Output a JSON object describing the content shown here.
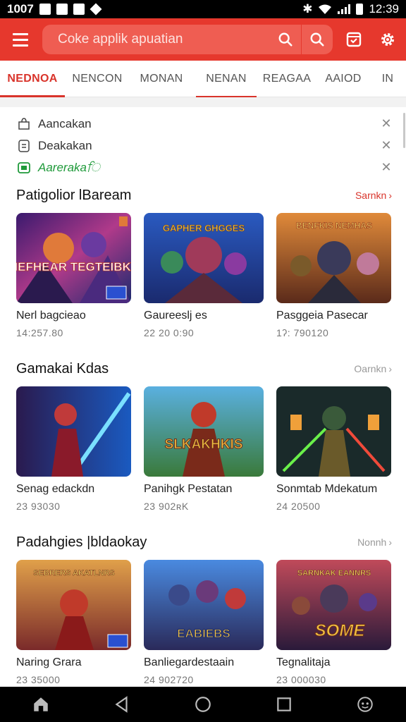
{
  "status_bar": {
    "time": "12:39",
    "left_text": "1007"
  },
  "search": {
    "placeholder": "Coke applik apuatian"
  },
  "tabs": [
    {
      "label": "NEDNOA"
    },
    {
      "label": "NENCON"
    },
    {
      "label": "MONAN"
    },
    {
      "label": "NENAN"
    },
    {
      "label": "REAGAA"
    },
    {
      "label": "AAIOD"
    },
    {
      "label": "IN"
    }
  ],
  "recent": [
    {
      "label": "Aancakan",
      "icon": "bag-icon"
    },
    {
      "label": "Deakakan",
      "icon": "document-icon"
    },
    {
      "label": "Aarerakaਿ",
      "icon": "app-store-icon"
    }
  ],
  "sections": [
    {
      "title": "Patigolior lBaream",
      "more": "Sarnkn",
      "items": [
        {
          "name": "Nerl bagcieao",
          "meta": "14:257.80",
          "art": "NEFHEAR TEGTEIBKY"
        },
        {
          "name": "Gaureeslj es",
          "meta": "22 20 0:90",
          "art": "GAPHER GHGGES"
        },
        {
          "name": "Pasggeia Pasecar",
          "meta": "1ʔ: 790120",
          "art": "BENFKIS NEMHAS"
        }
      ]
    },
    {
      "title": "Gamakai Kdas",
      "more": "Oarnkn",
      "items": [
        {
          "name": "Senag edackdn",
          "meta": "23 93030",
          "art": ""
        },
        {
          "name": "Panihgk Pestatan",
          "meta": "23 902ʀK",
          "art": "SLKAKHKIS"
        },
        {
          "name": "Sonmtab Mdekatum",
          "meta": "24 20500",
          "art": ""
        }
      ]
    },
    {
      "title": "Padahgies |bldaokay",
      "more": "Nonnh",
      "items": [
        {
          "name": "Naring Grara",
          "meta": "23 35000",
          "art": "SEBRERS AKATLNRS"
        },
        {
          "name": "Banliegardestaain",
          "meta": "24 902720",
          "art": "EABIEBS"
        },
        {
          "name": "Tegnalitaja",
          "meta": "23 000030",
          "art": "SOME"
        }
      ]
    }
  ],
  "colors": {
    "accent": "#e6382d",
    "accent_dark": "#d9342b",
    "green": "#1f9a3a"
  }
}
